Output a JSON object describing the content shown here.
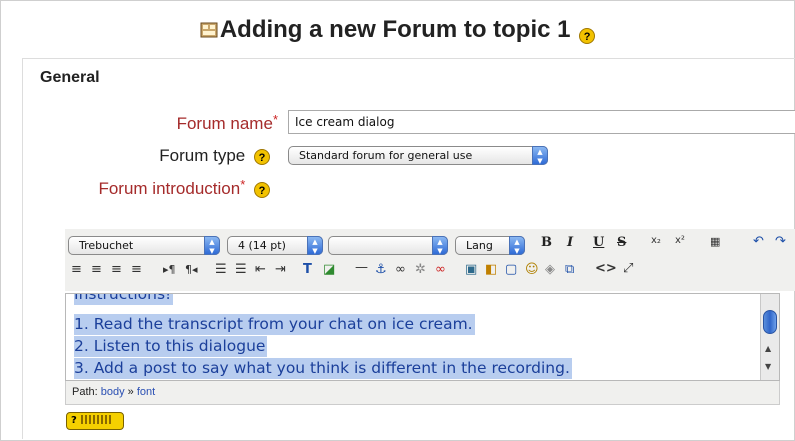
{
  "page": {
    "title": "Adding a new Forum to topic 1",
    "title_help": "?"
  },
  "general": {
    "legend": "General",
    "forum_name_label": "Forum name",
    "forum_name_required": "*",
    "forum_name_value": "Ice cream dialog",
    "forum_type_label": "Forum type",
    "forum_type_value": "Standard forum for general use",
    "forum_intro_label": "Forum introduction",
    "forum_intro_required": "*",
    "help_glyph": "?"
  },
  "toolbar": {
    "font_family": "Trebuchet",
    "font_size": "4 (14 pt)",
    "font_format": "",
    "lang": "Lang",
    "bold": "B",
    "italic": "I",
    "underline": "U",
    "strike": "S"
  },
  "editor": {
    "lines": [
      "Instructions!",
      "1. Read the transcript from your chat on ice cream.",
      "2. Listen to this dialogue",
      "3. Add a post to say what you think is different in the recording."
    ]
  },
  "path": {
    "label": "Path:",
    "body": "body",
    "separator": "»",
    "font": "font"
  },
  "help_button": "?"
}
